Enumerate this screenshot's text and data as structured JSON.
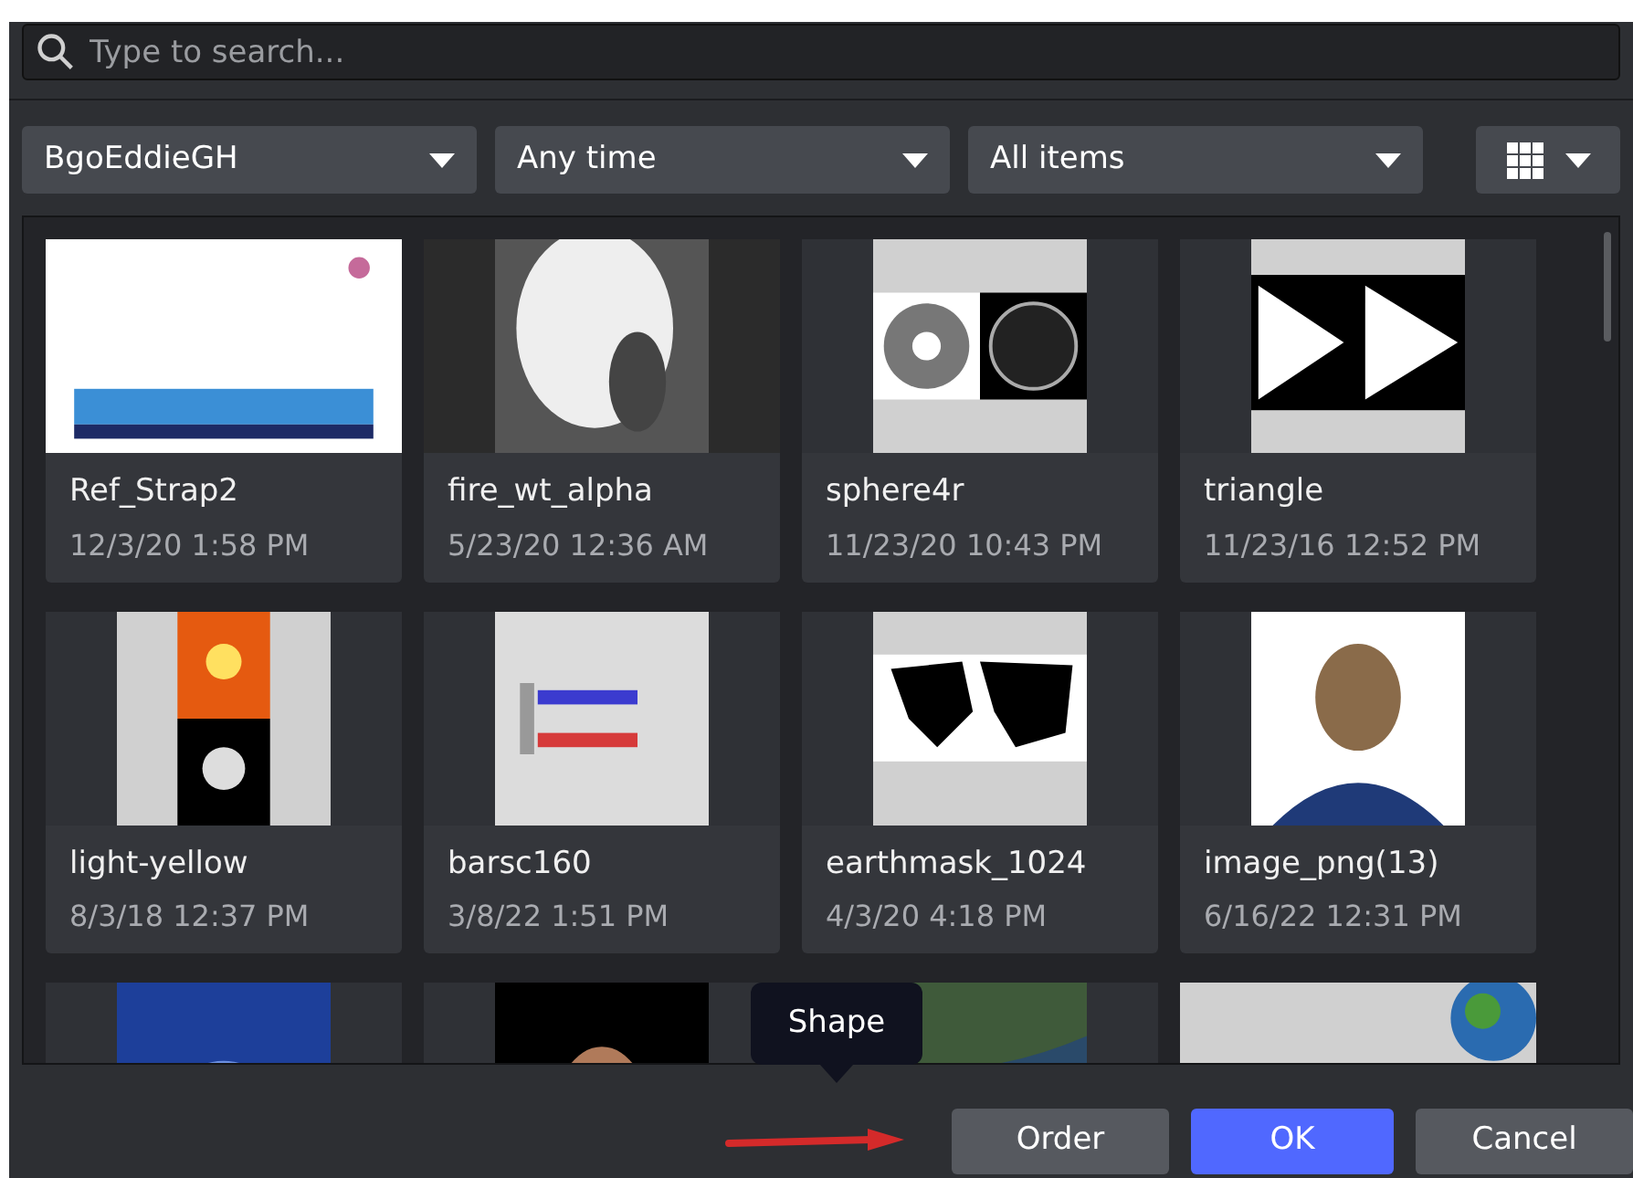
{
  "search": {
    "placeholder": "Type to search..."
  },
  "filters": [
    {
      "kind": "dropdown",
      "value": "BgoEddieGH"
    },
    {
      "kind": "dropdown",
      "value": "Any time"
    },
    {
      "kind": "dropdown",
      "value": "All items"
    },
    {
      "kind": "view"
    }
  ],
  "assets": [
    {
      "kind": "asset",
      "name": "Ref_Strap2",
      "date": "12/3/20 1:58 PM"
    },
    {
      "kind": "asset",
      "name": "fire_wt_alpha",
      "date": "5/23/20 12:36 AM"
    },
    {
      "kind": "asset",
      "name": "sphere4r",
      "date": "11/23/20 10:43 PM"
    },
    {
      "kind": "asset",
      "name": "triangle",
      "date": "11/23/16 12:52 PM"
    },
    {
      "kind": "asset",
      "name": "light-yellow",
      "date": "8/3/18 12:37 PM"
    },
    {
      "kind": "asset",
      "name": "barsc160",
      "date": "3/8/22 1:51 PM"
    },
    {
      "kind": "asset",
      "name": "earthmask_1024",
      "date": "4/3/20 4:18 PM"
    },
    {
      "kind": "asset",
      "name": "image_png(13)",
      "date": "6/16/22 12:31 PM"
    },
    {
      "kind": "picture"
    },
    {
      "kind": "picture"
    },
    {
      "kind": "picture"
    },
    {
      "kind": "picture"
    }
  ],
  "tooltip": "Shape",
  "buttons": [
    {
      "label": "Order",
      "kind": "secondary"
    },
    {
      "label": "OK",
      "kind": "primary"
    },
    {
      "label": "Cancel",
      "kind": "secondary"
    }
  ]
}
